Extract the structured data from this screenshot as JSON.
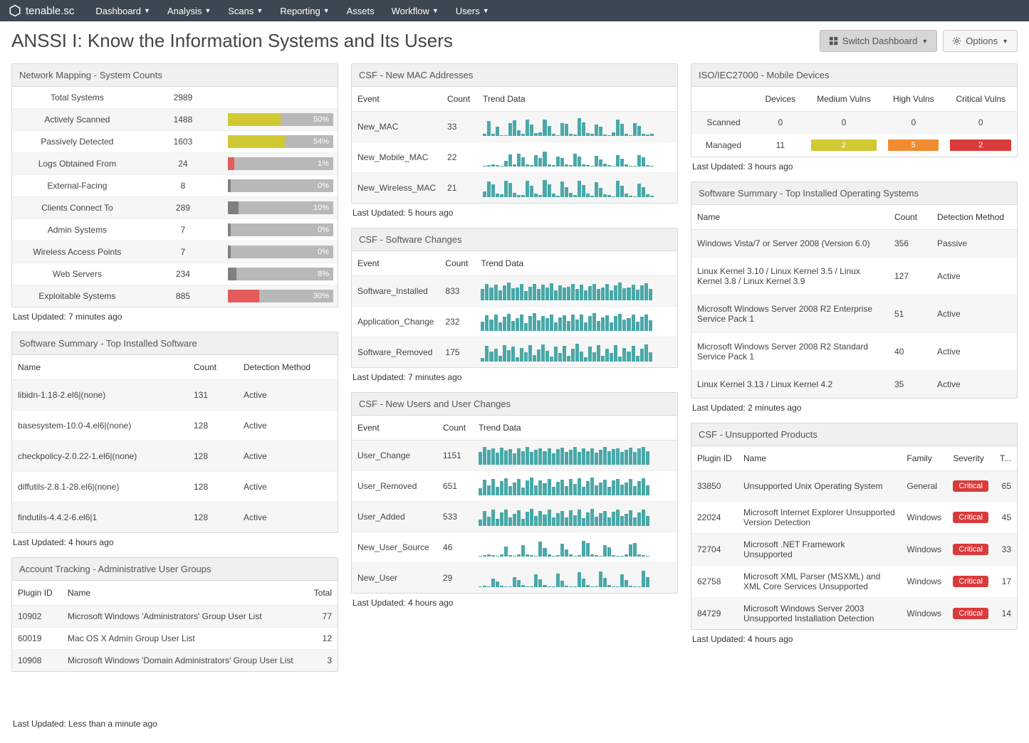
{
  "brand": "tenable.sc",
  "nav": [
    "Dashboard",
    "Analysis",
    "Scans",
    "Reporting",
    "Assets",
    "Workflow",
    "Users"
  ],
  "nav_no_caret": [
    "Assets"
  ],
  "page_title": "ANSSI I: Know the Information Systems and Its Users",
  "buttons": {
    "switch": "Switch Dashboard",
    "options": "Options"
  },
  "network_mapping": {
    "title": "Network Mapping - System Counts",
    "rows": [
      {
        "label": "Total Systems",
        "count": "2989",
        "pct": null,
        "color": null
      },
      {
        "label": "Actively Scanned",
        "count": "1488",
        "pct": "50%",
        "fill": 50,
        "color": "c-yellow"
      },
      {
        "label": "Passively Detected",
        "count": "1603",
        "pct": "54%",
        "fill": 54,
        "color": "c-yellow"
      },
      {
        "label": "Logs Obtained From",
        "count": "24",
        "pct": "1%",
        "fill": 6,
        "color": "c-red"
      },
      {
        "label": "External-Facing",
        "count": "8",
        "pct": "0%",
        "fill": 0,
        "color": "c-gray"
      },
      {
        "label": "Clients Connect To",
        "count": "289",
        "pct": "10%",
        "fill": 10,
        "color": "c-gray"
      },
      {
        "label": "Admin Systems",
        "count": "7",
        "pct": "0%",
        "fill": 0,
        "color": "c-gray"
      },
      {
        "label": "Wireless Access Points",
        "count": "7",
        "pct": "0%",
        "fill": 0,
        "color": "c-gray"
      },
      {
        "label": "Web Servers",
        "count": "234",
        "pct": "8%",
        "fill": 8,
        "color": "c-gray"
      },
      {
        "label": "Exploitable Systems",
        "count": "885",
        "pct": "30%",
        "fill": 30,
        "color": "c-red"
      }
    ],
    "updated": "Last Updated: 7 minutes ago"
  },
  "soft_summary": {
    "title": "Software Summary - Top Installed Software",
    "headers": [
      "Name",
      "Count",
      "Detection Method"
    ],
    "rows": [
      {
        "name": "libidn-1.18-2.el6|(none)",
        "count": "131",
        "method": "Active"
      },
      {
        "name": "basesystem-10.0-4.el6|(none)",
        "count": "128",
        "method": "Active"
      },
      {
        "name": "checkpolicy-2.0.22-1.el6|(none)",
        "count": "128",
        "method": "Active"
      },
      {
        "name": "diffutils-2.8.1-28.el6|(none)",
        "count": "128",
        "method": "Active"
      },
      {
        "name": "findutils-4.4.2-6.el6|1",
        "count": "128",
        "method": "Active"
      }
    ],
    "updated": "Last Updated: 4 hours ago"
  },
  "account_tracking": {
    "title": "Account Tracking - Administrative User Groups",
    "headers": [
      "Plugin ID",
      "Name",
      "Total"
    ],
    "rows": [
      {
        "id": "10902",
        "name": "Microsoft Windows 'Administrators' Group User List",
        "total": "77"
      },
      {
        "id": "60019",
        "name": "Mac OS X Admin Group User List",
        "total": "12"
      },
      {
        "id": "10908",
        "name": "Microsoft Windows 'Domain Administrators' Group User List",
        "total": "3"
      }
    ],
    "updated": "Last Updated: Less than a minute ago"
  },
  "csf_mac": {
    "title": "CSF - New MAC Addresses",
    "headers": [
      "Event",
      "Count",
      "Trend Data"
    ],
    "rows": [
      {
        "event": "New_MAC",
        "count": "33"
      },
      {
        "event": "New_Mobile_MAC",
        "count": "22"
      },
      {
        "event": "New_Wireless_MAC",
        "count": "21"
      }
    ],
    "updated": "Last Updated: 5 hours ago"
  },
  "csf_software": {
    "title": "CSF - Software Changes",
    "headers": [
      "Event",
      "Count",
      "Trend Data"
    ],
    "rows": [
      {
        "event": "Software_Installed",
        "count": "833"
      },
      {
        "event": "Application_Change",
        "count": "232"
      },
      {
        "event": "Software_Removed",
        "count": "175"
      }
    ],
    "updated": "Last Updated: 7 minutes ago"
  },
  "csf_users": {
    "title": "CSF - New Users and User Changes",
    "headers": [
      "Event",
      "Count",
      "Trend Data"
    ],
    "rows": [
      {
        "event": "User_Change",
        "count": "1151"
      },
      {
        "event": "User_Removed",
        "count": "651"
      },
      {
        "event": "User_Added",
        "count": "533"
      },
      {
        "event": "New_User_Source",
        "count": "46"
      },
      {
        "event": "New_User",
        "count": "29"
      }
    ],
    "updated": "Last Updated: 4 hours ago"
  },
  "iso_mobile": {
    "title": "ISO/IEC27000 - Mobile Devices",
    "headers": [
      "",
      "Devices",
      "Medium Vulns",
      "High Vulns",
      "Critical Vulns"
    ],
    "rows": [
      {
        "label": "Scanned",
        "devices": "0",
        "med": "0",
        "high": "0",
        "crit": "0",
        "plain": true
      },
      {
        "label": "Managed",
        "devices": "11",
        "med": "2",
        "high": "5",
        "crit": "2",
        "plain": false
      }
    ],
    "updated": "Last Updated: 3 hours ago"
  },
  "soft_os": {
    "title": "Software Summary - Top Installed Operating Systems",
    "headers": [
      "Name",
      "Count",
      "Detection Method"
    ],
    "rows": [
      {
        "name": "Windows Vista/7 or Server 2008 (Version 6.0)",
        "count": "356",
        "method": "Passive"
      },
      {
        "name": "Linux Kernel 3.10 / Linux Kernel 3.5 / Linux Kernel 3.8 / Linux Kernel 3.9",
        "count": "127",
        "method": "Active"
      },
      {
        "name": "Microsoft Windows Server 2008 R2 Enterprise Service Pack 1",
        "count": "51",
        "method": "Active"
      },
      {
        "name": "Microsoft Windows Server 2008 R2 Standard Service Pack 1",
        "count": "40",
        "method": "Active"
      },
      {
        "name": "Linux Kernel 3.13 / Linux Kernel 4.2",
        "count": "35",
        "method": "Active"
      }
    ],
    "updated": "Last Updated: 2 minutes ago"
  },
  "csf_unsupported": {
    "title": "CSF - Unsupported Products",
    "headers": [
      "Plugin ID",
      "Name",
      "Family",
      "Severity",
      "T..."
    ],
    "sev_label": "Critical",
    "rows": [
      {
        "id": "33850",
        "name": "Unsupported Unix Operating System",
        "family": "General",
        "total": "65"
      },
      {
        "id": "22024",
        "name": "Microsoft Internet Explorer Unsupported Version Detection",
        "family": "Windows",
        "total": "45"
      },
      {
        "id": "72704",
        "name": "Microsoft .NET Framework Unsupported",
        "family": "Windows",
        "total": "33"
      },
      {
        "id": "62758",
        "name": "Microsoft XML Parser (MSXML) and XML Core Services Unsupported",
        "family": "Windows",
        "total": "17"
      },
      {
        "id": "84729",
        "name": "Microsoft Windows Server 2003 Unsupported Installation Detection",
        "family": "Windows",
        "total": "14"
      }
    ],
    "updated": "Last Updated: 4 hours ago"
  },
  "chart_data": [
    {
      "type": "bar",
      "title": "New_MAC trend",
      "series": "New_MAC",
      "values": [
        12,
        80,
        10,
        50,
        4,
        5,
        70,
        85,
        30,
        10,
        90,
        60,
        15,
        18,
        88,
        55,
        10,
        5,
        70,
        65,
        12,
        8,
        95,
        75,
        15,
        10,
        60,
        50,
        8,
        5,
        20,
        90,
        65,
        10,
        5,
        70,
        55,
        12,
        8,
        10
      ]
    },
    {
      "type": "bar",
      "title": "New_Mobile_MAC trend",
      "series": "New_Mobile_MAC",
      "values": [
        5,
        8,
        10,
        6,
        4,
        30,
        65,
        12,
        70,
        50,
        10,
        8,
        60,
        45,
        80,
        10,
        6,
        55,
        48,
        10,
        8,
        68,
        52,
        12,
        6,
        5,
        58,
        40,
        15,
        8,
        5,
        62,
        44,
        12,
        5,
        4,
        60,
        50,
        8,
        5
      ]
    },
    {
      "type": "bar",
      "title": "New_Wireless_MAC trend",
      "series": "New_Wireless_MAC",
      "values": [
        30,
        85,
        70,
        20,
        15,
        90,
        78,
        25,
        10,
        12,
        88,
        60,
        18,
        10,
        92,
        70,
        20,
        8,
        85,
        55,
        22,
        10,
        90,
        65,
        18,
        8,
        80,
        50,
        15,
        10,
        5,
        88,
        60,
        20,
        8,
        5,
        75,
        55,
        15,
        8
      ]
    },
    {
      "type": "bar",
      "title": "Software_Installed trend",
      "series": "Software_Installed",
      "values": [
        60,
        90,
        70,
        85,
        55,
        80,
        95,
        65,
        70,
        88,
        50,
        75,
        90,
        60,
        85,
        70,
        92,
        55,
        80,
        68,
        75,
        90,
        62,
        85,
        55,
        78,
        90,
        60,
        70,
        88,
        52,
        82,
        95,
        65,
        70,
        85,
        58,
        80,
        92,
        60
      ]
    },
    {
      "type": "bar",
      "title": "Application_Change trend",
      "series": "Application_Change",
      "values": [
        50,
        85,
        60,
        90,
        45,
        78,
        92,
        55,
        70,
        88,
        42,
        80,
        95,
        58,
        82,
        68,
        90,
        48,
        75,
        85,
        52,
        88,
        62,
        90,
        45,
        80,
        95,
        55,
        72,
        85,
        48,
        82,
        92,
        60,
        70,
        88,
        50,
        78,
        90,
        58
      ]
    },
    {
      "type": "bar",
      "title": "Software_Removed trend",
      "series": "Software_Removed",
      "values": [
        20,
        85,
        55,
        70,
        30,
        90,
        60,
        80,
        25,
        75,
        50,
        88,
        35,
        65,
        92,
        58,
        28,
        80,
        48,
        85,
        32,
        70,
        95,
        55,
        25,
        82,
        50,
        88,
        30,
        68,
        45,
        90,
        28,
        75,
        55,
        85,
        32,
        70,
        92,
        50
      ]
    },
    {
      "type": "bar",
      "title": "User_Change trend",
      "series": "User_Change",
      "values": [
        70,
        95,
        80,
        88,
        65,
        92,
        78,
        85,
        60,
        90,
        72,
        95,
        68,
        82,
        90,
        75,
        88,
        62,
        85,
        92,
        70,
        80,
        95,
        68,
        88,
        75,
        90,
        65,
        82,
        95,
        72,
        85,
        90,
        68,
        80,
        92,
        70,
        88,
        95,
        75
      ]
    },
    {
      "type": "bar",
      "title": "User_Removed trend",
      "series": "User_Removed",
      "values": [
        40,
        85,
        55,
        90,
        45,
        78,
        92,
        50,
        68,
        88,
        42,
        80,
        95,
        55,
        82,
        65,
        90,
        48,
        72,
        85,
        50,
        88,
        60,
        92,
        45,
        78,
        95,
        52,
        70,
        85,
        48,
        82,
        90,
        58,
        68,
        88,
        50,
        78,
        92,
        55
      ]
    },
    {
      "type": "bar",
      "title": "User_Added trend",
      "series": "User_Added",
      "values": [
        35,
        80,
        50,
        88,
        40,
        75,
        90,
        48,
        65,
        85,
        38,
        78,
        92,
        52,
        80,
        62,
        88,
        45,
        70,
        82,
        48,
        85,
        58,
        90,
        42,
        75,
        92,
        50,
        68,
        82,
        45,
        78,
        88,
        55,
        65,
        85,
        48,
        75,
        90,
        52
      ]
    },
    {
      "type": "bar",
      "title": "New_User_Source trend",
      "series": "New_User_Source",
      "values": [
        5,
        8,
        12,
        6,
        4,
        10,
        55,
        8,
        5,
        12,
        60,
        10,
        6,
        4,
        80,
        48,
        12,
        5,
        8,
        70,
        40,
        10,
        4,
        6,
        85,
        75,
        12,
        8,
        4,
        62,
        50,
        8,
        5,
        4,
        10,
        65,
        72,
        12,
        6,
        4
      ]
    },
    {
      "type": "bar",
      "title": "New_User trend",
      "series": "New_User",
      "values": [
        4,
        6,
        5,
        45,
        30,
        8,
        5,
        4,
        55,
        38,
        10,
        5,
        4,
        68,
        42,
        12,
        5,
        4,
        72,
        35,
        8,
        5,
        4,
        80,
        48,
        10,
        5,
        4,
        85,
        50,
        12,
        5,
        4,
        70,
        40,
        8,
        5,
        4,
        90,
        55
      ]
    }
  ]
}
